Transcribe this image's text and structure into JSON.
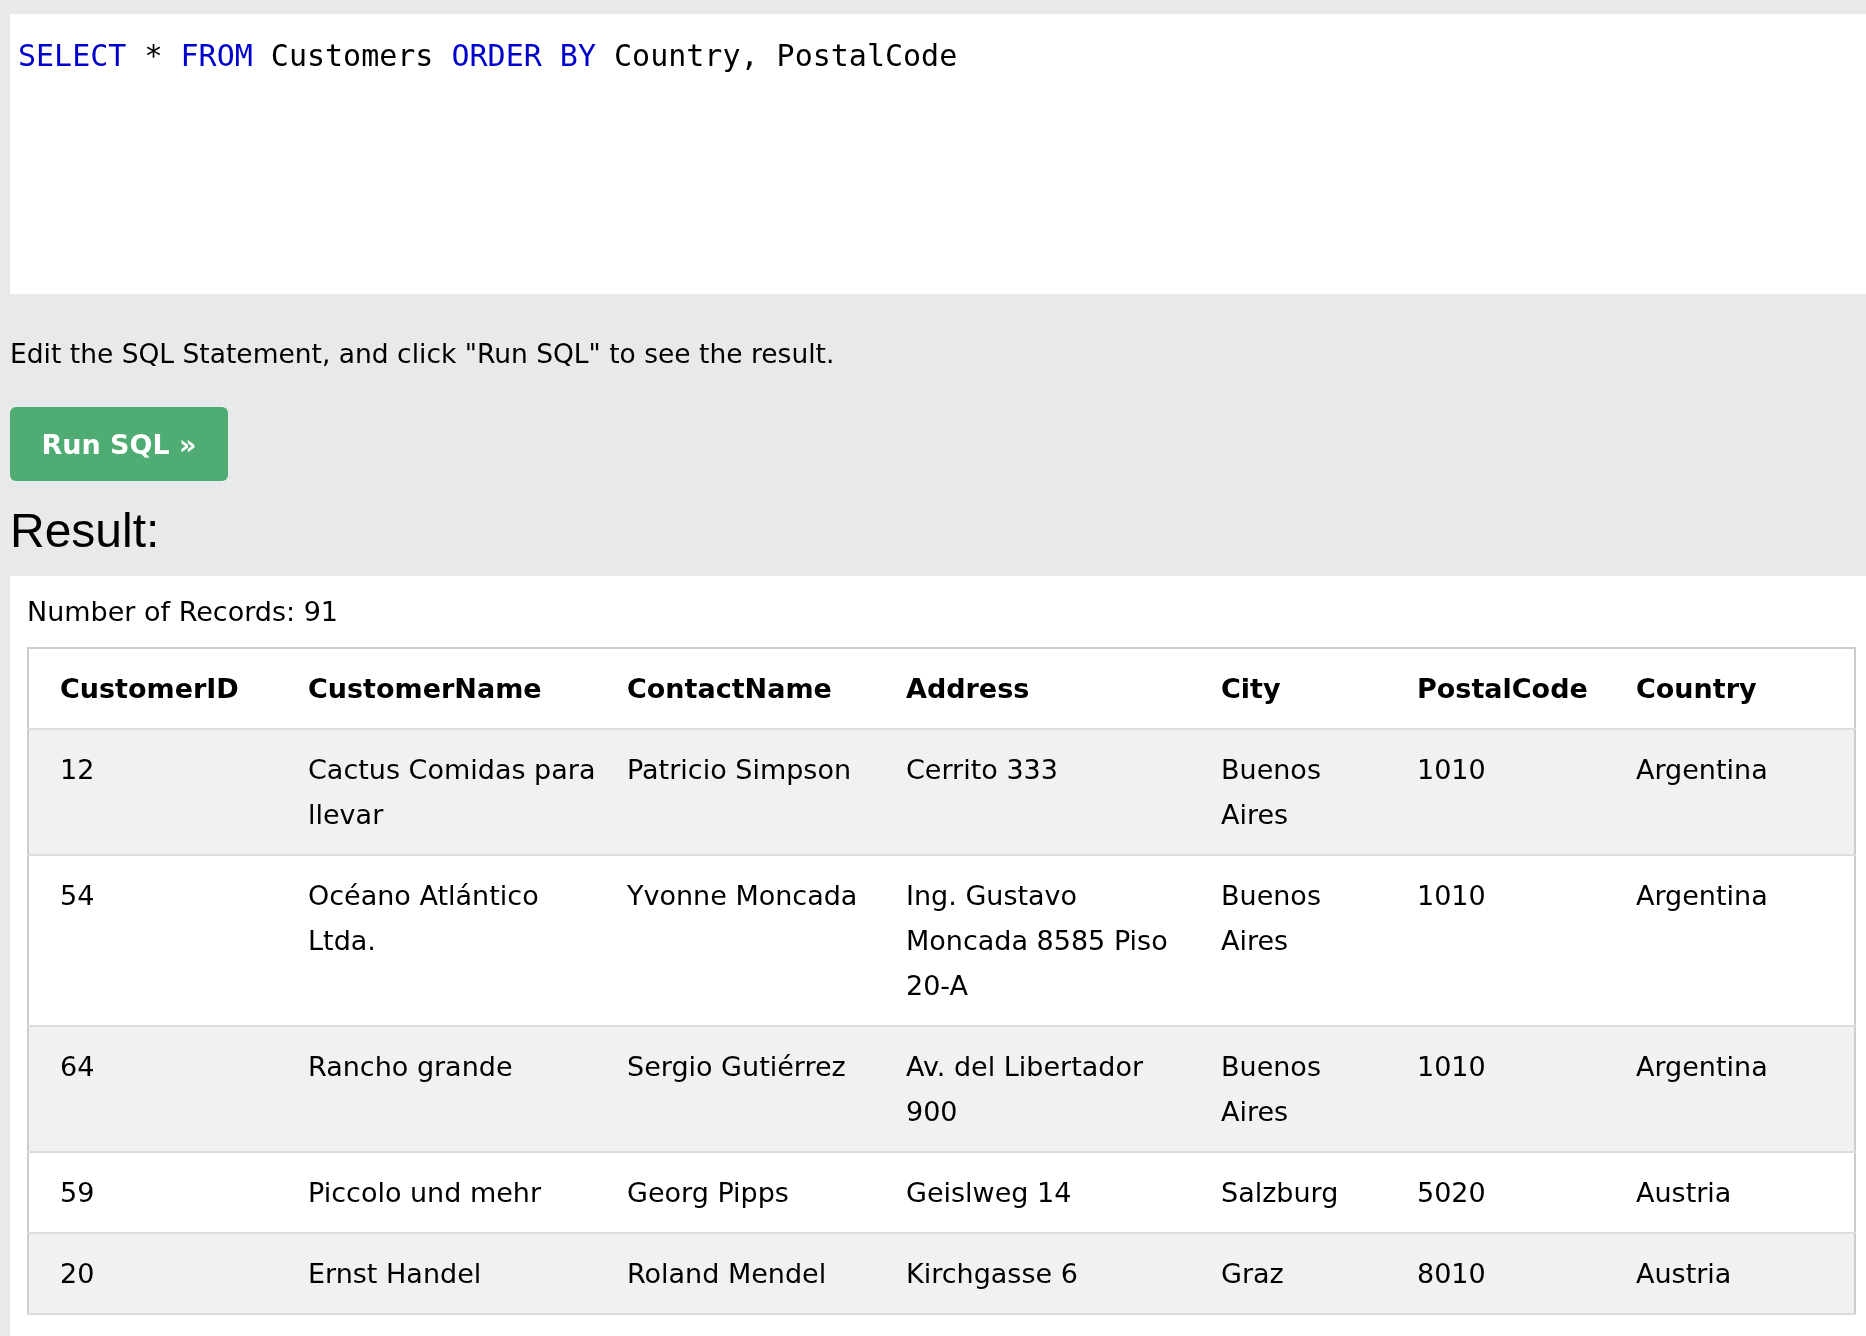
{
  "editor": {
    "tokens": [
      {
        "kind": "keyword",
        "text": "SELECT"
      },
      {
        "kind": "plain",
        "text": " * "
      },
      {
        "kind": "keyword",
        "text": "FROM"
      },
      {
        "kind": "plain",
        "text": " Customers "
      },
      {
        "kind": "keyword",
        "text": "ORDER BY"
      },
      {
        "kind": "plain",
        "text": " Country, PostalCode"
      }
    ]
  },
  "instruction": "Edit the SQL Statement, and click \"Run SQL\" to see the result.",
  "run_button": "Run SQL »",
  "result_heading": "Result:",
  "record_count": "Number of Records: 91",
  "table": {
    "columns": [
      "CustomerID",
      "CustomerName",
      "ContactName",
      "Address",
      "City",
      "PostalCode",
      "Country"
    ],
    "rows": [
      [
        "12",
        "Cactus Comidas para llevar",
        "Patricio Simpson",
        "Cerrito 333",
        "Buenos Aires",
        "1010",
        "Argentina"
      ],
      [
        "54",
        "Océano Atlántico Ltda.",
        "Yvonne Moncada",
        "Ing. Gustavo Moncada 8585 Piso 20-A",
        "Buenos Aires",
        "1010",
        "Argentina"
      ],
      [
        "64",
        "Rancho grande",
        "Sergio Gutiérrez",
        "Av. del Libertador 900",
        "Buenos Aires",
        "1010",
        "Argentina"
      ],
      [
        "59",
        "Piccolo und mehr",
        "Georg Pipps",
        "Geislweg 14",
        "Salzburg",
        "5020",
        "Austria"
      ],
      [
        "20",
        "Ernst Handel",
        "Roland Mendel",
        "Kirchgasse 6",
        "Graz",
        "8010",
        "Austria"
      ]
    ]
  }
}
